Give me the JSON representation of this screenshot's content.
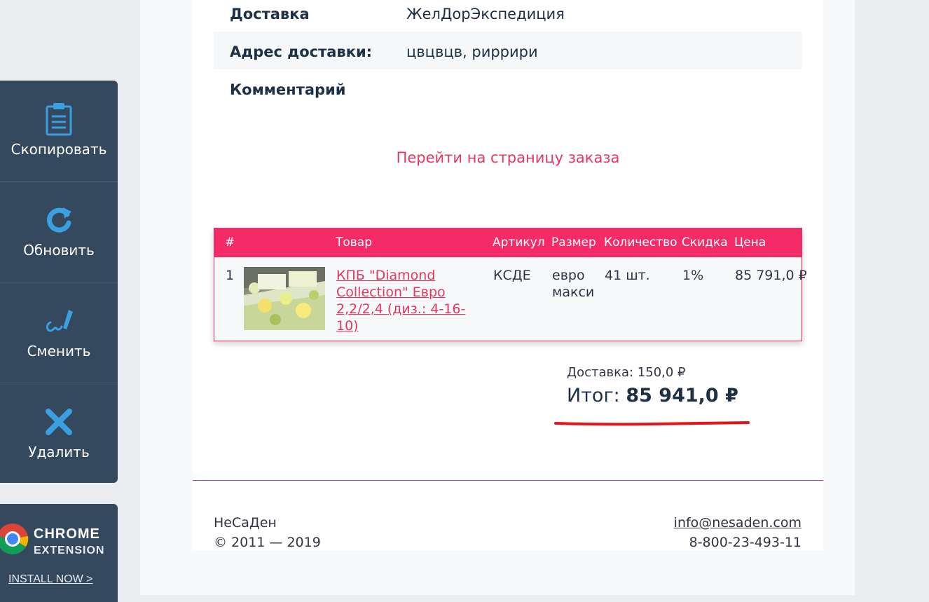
{
  "sidebar": {
    "items": [
      {
        "label": "Скопировать",
        "icon": "clipboard-icon"
      },
      {
        "label": "Обновить",
        "icon": "refresh-icon"
      },
      {
        "label": "Сменить",
        "icon": "edit-pen-icon"
      },
      {
        "label": "Удалить",
        "icon": "delete-x-icon"
      }
    ],
    "chrome": {
      "line1": "CHROME",
      "line2": "EXTENSION",
      "cta": "INSTALL NOW >"
    }
  },
  "order": {
    "rows": [
      {
        "key": "Доставка",
        "value": "ЖелДорЭкспедиция"
      },
      {
        "key": "Адрес доставки:",
        "value": "цвцвцв, риррири"
      },
      {
        "key": "Комментарий",
        "value": ""
      }
    ],
    "goto_link": "Перейти на страницу заказа"
  },
  "table": {
    "headers": [
      "#",
      "Товар",
      "Артикул",
      "Размер",
      "Количество",
      "Скидка",
      "Цена"
    ],
    "rows": [
      {
        "num": "1",
        "product_line1": "КПБ \"Diamond",
        "product_line2": "Collection\" Евро",
        "product_line3": "2,2/2,4 (диз.: 4-16-10)",
        "sku": "КСДЕ",
        "size_line1": "евро",
        "size_line2": "макси",
        "qty": "41 шт.",
        "discount": "1%",
        "price": "85 791,0 ₽"
      }
    ]
  },
  "totals": {
    "delivery": "Доставка: 150,0 ₽",
    "total_label": "Итог:",
    "total_value": "85 941,0 ₽"
  },
  "footer": {
    "brand": "НеСаДен",
    "copyright": "© 2011 — 2019",
    "email": "info@nesaden.com",
    "phone": "8-800-23-493-11"
  },
  "colors": {
    "accent": "#f52b67",
    "link": "#e4385f",
    "sidebar": "#34495e",
    "icon": "#3aa0e0"
  }
}
